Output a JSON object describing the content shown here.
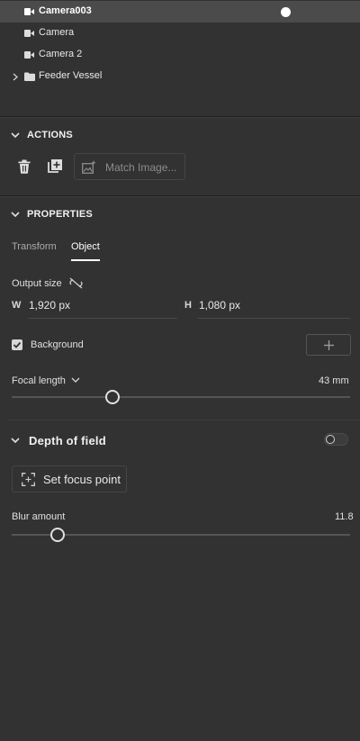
{
  "layers": {
    "items": [
      {
        "label": "Camera003",
        "icon": "camera-icon",
        "selected": true
      },
      {
        "label": "Camera",
        "icon": "camera-icon"
      },
      {
        "label": "Camera 2",
        "icon": "camera-icon"
      },
      {
        "label": "Feeder Vessel",
        "icon": "folder-icon",
        "expandable": true
      }
    ]
  },
  "actions": {
    "title": "ACTIONS",
    "match_image_label": "Match Image..."
  },
  "properties": {
    "title": "PROPERTIES",
    "tabs": [
      {
        "label": "Transform",
        "active": false
      },
      {
        "label": "Object",
        "active": true
      }
    ],
    "output_size_label": "Output size",
    "width_letter": "W",
    "width_value": "1,920 px",
    "height_letter": "H",
    "height_value": "1,080 px",
    "background_label": "Background",
    "background_checked": true,
    "focal_length_label": "Focal length",
    "focal_length_value": "43 mm"
  },
  "depth_of_field": {
    "title": "Depth of field",
    "enabled": false,
    "set_focus_label": "Set focus point",
    "blur_label": "Blur amount",
    "blur_value": "11.8"
  },
  "colors": {
    "panel_bg": "#323232",
    "selected_row": "#4b4b4b",
    "text": "#e6e6e6"
  }
}
